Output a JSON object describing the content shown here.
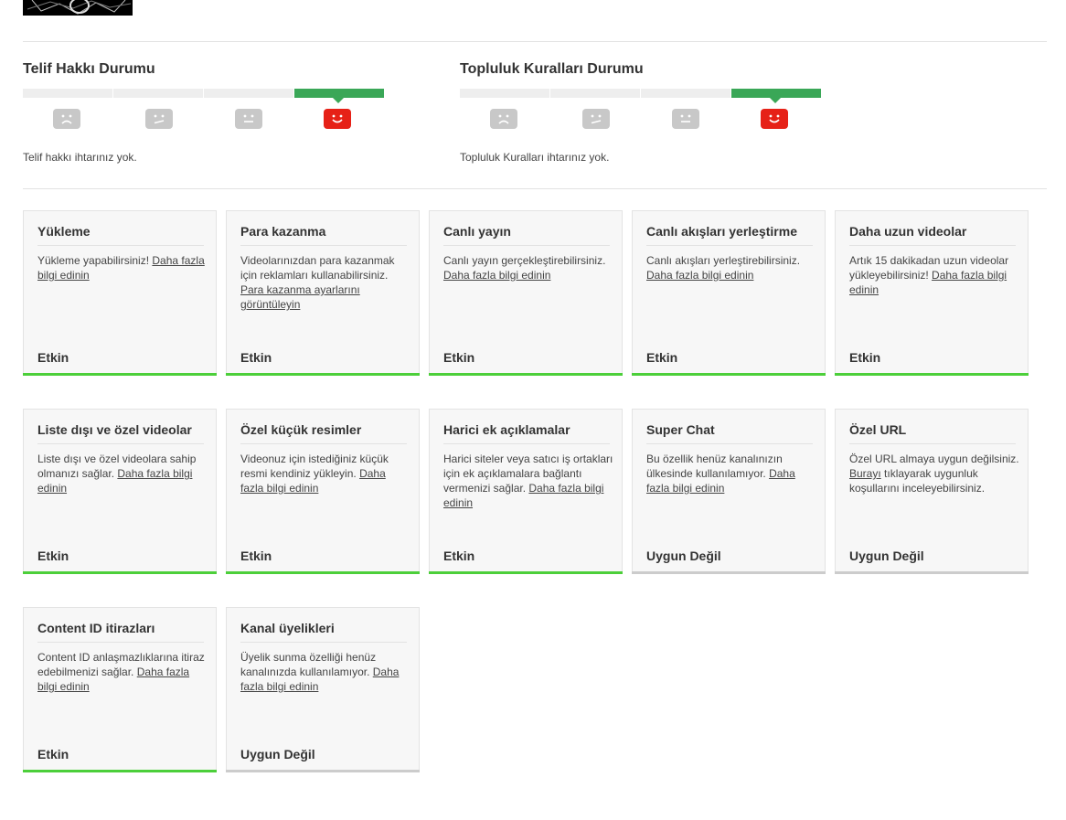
{
  "copyright": {
    "title": "Telif Hakkı Durumu",
    "message": "Telif hakkı ihtarınız yok.",
    "active_level": 3
  },
  "community": {
    "title": "Topluluk Kuralları Durumu",
    "message": "Topluluk Kuralları ihtarınız yok.",
    "active_level": 3
  },
  "colors": {
    "meter_active": "#3aa757",
    "face_inactive": "#c8c8c8",
    "face_active": "#e62117",
    "enabled_bar": "#4ccf3a",
    "disabled_bar": "#cccccc"
  },
  "features": [
    {
      "title": "Yükleme",
      "text": "Yükleme yapabilirsiniz! ",
      "link": "Daha fazla bilgi edinin",
      "status": "Etkin",
      "enabled": true
    },
    {
      "title": "Para kazanma",
      "text": "Videolarınızdan para kazanmak için reklamları kullanabilirsiniz. ",
      "link": "Para kazanma ayarlarını görüntüleyin",
      "status": "Etkin",
      "enabled": true
    },
    {
      "title": "Canlı yayın",
      "text": "Canlı yayın gerçekleştirebilirsiniz. ",
      "link": "Daha fazla bilgi edinin",
      "status": "Etkin",
      "enabled": true
    },
    {
      "title": "Canlı akışları yerleştirme",
      "text": "Canlı akışları yerleştirebilirsiniz. ",
      "link": "Daha fazla bilgi edinin",
      "status": "Etkin",
      "enabled": true
    },
    {
      "title": "Daha uzun videolar",
      "text": "Artık 15 dakikadan uzun videolar yükleyebilirsiniz! ",
      "link": "Daha fazla bilgi edinin",
      "status": "Etkin",
      "enabled": true
    },
    {
      "title": "Liste dışı ve özel videolar",
      "text": "Liste dışı ve özel videolara sahip olmanızı sağlar. ",
      "link": "Daha fazla bilgi edinin",
      "status": "Etkin",
      "enabled": true
    },
    {
      "title": "Özel küçük resimler",
      "text": "Videonuz için istediğiniz küçük resmi kendiniz yükleyin. ",
      "link": "Daha fazla bilgi edinin",
      "status": "Etkin",
      "enabled": true
    },
    {
      "title": "Harici ek açıklamalar",
      "text": "Harici siteler veya satıcı iş ortakları için ek açıklamalara bağlantı vermenizi sağlar. ",
      "link": "Daha fazla bilgi edinin",
      "status": "Etkin",
      "enabled": true
    },
    {
      "title": "Super Chat",
      "text": "Bu özellik henüz kanalınızın ülkesinde kullanılamıyor. ",
      "link": "Daha fazla bilgi edinin",
      "status": "Uygun Değil",
      "enabled": false
    },
    {
      "title": "Özel URL",
      "text_before": "Özel URL almaya uygun değilsiniz. ",
      "link": "Burayı",
      "text_after": " tıklayarak uygunluk koşullarını inceleyebilirsiniz.",
      "status": "Uygun Değil",
      "enabled": false
    },
    {
      "title": "Content ID itirazları",
      "text": "Content ID anlaşmazlıklarına itiraz edebilmenizi sağlar. ",
      "link": "Daha fazla bilgi edinin",
      "status": "Etkin",
      "enabled": true
    },
    {
      "title": "Kanal üyelikleri",
      "text": "Üyelik sunma özelliği henüz kanalınızda kullanılamıyor. ",
      "link": "Daha fazla bilgi edinin",
      "status": "Uygun Değil",
      "enabled": false
    }
  ]
}
